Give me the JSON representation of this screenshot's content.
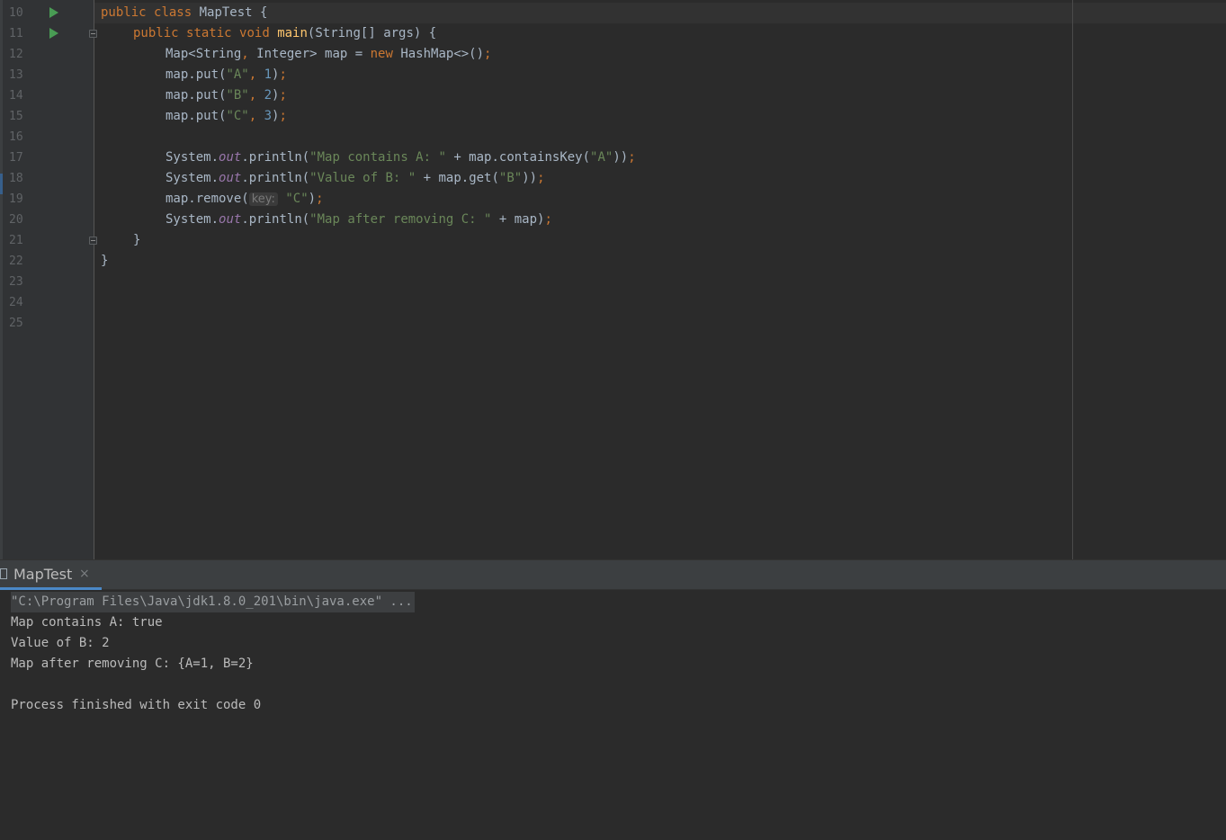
{
  "editor": {
    "line_numbers": [
      "10",
      "11",
      "12",
      "13",
      "14",
      "15",
      "16",
      "17",
      "18",
      "19",
      "20",
      "21",
      "22",
      "23",
      "24",
      "25"
    ],
    "code": {
      "l10": {
        "kw1": "public ",
        "kw2": "class ",
        "name": "MapTest {"
      },
      "l11": {
        "kw1": "public ",
        "kw2": "static ",
        "kw3": "void ",
        "method": "main",
        "params": "(String[] args) {"
      },
      "l12": {
        "a": "Map<String",
        "comma": ", ",
        "b": "Integer> map = ",
        "kw": "new ",
        "c": "HashMap<>()",
        "semi": ";"
      },
      "l13": {
        "a": "map.put(",
        "s": "\"A\"",
        "comma": ", ",
        "n": "1",
        "b": ")",
        "semi": ";"
      },
      "l14": {
        "a": "map.put(",
        "s": "\"B\"",
        "comma": ", ",
        "n": "2",
        "b": ")",
        "semi": ";"
      },
      "l15": {
        "a": "map.put(",
        "s": "\"C\"",
        "comma": ", ",
        "n": "3",
        "b": ")",
        "semi": ";"
      },
      "l17": {
        "a": "System.",
        "f": "out",
        "b": ".println(",
        "s": "\"Map contains A: \"",
        "c": " + map.containsKey(",
        "s2": "\"A\"",
        "d": "))",
        "semi": ";"
      },
      "l18": {
        "a": "System.",
        "f": "out",
        "b": ".println(",
        "s": "\"Value of B: \"",
        "c": " + map.get(",
        "s2": "\"B\"",
        "d": "))",
        "semi": ";"
      },
      "l19": {
        "a": "map.remove(",
        "hint": "key:",
        "s": "\"C\"",
        "b": ")",
        "semi": ";"
      },
      "l20": {
        "a": "System.",
        "f": "out",
        "b": ".println(",
        "s": "\"Map after removing C: \"",
        "c": " + map)",
        "semi": ";"
      },
      "l21": "}",
      "l22": "}"
    }
  },
  "run_panel": {
    "tab_label": "MapTest",
    "tab_close": "×",
    "console_lines": [
      "\"C:\\Program Files\\Java\\jdk1.8.0_201\\bin\\java.exe\" ...",
      "Map contains A: true",
      "Value of B: 2",
      "Map after removing C: {A=1, B=2}",
      "",
      "Process finished with exit code 0"
    ]
  },
  "colors": {
    "background": "#2b2b2b",
    "gutter": "#313335",
    "keyword": "#cc7832",
    "string": "#6a8759",
    "number": "#6897bb",
    "method": "#ffc66d",
    "static_field": "#9876aa",
    "run_icon": "#499c54"
  },
  "icons": {
    "run": "run-triangle-icon",
    "fold": "fold-icon",
    "tab": "file-icon",
    "close": "close-icon"
  }
}
